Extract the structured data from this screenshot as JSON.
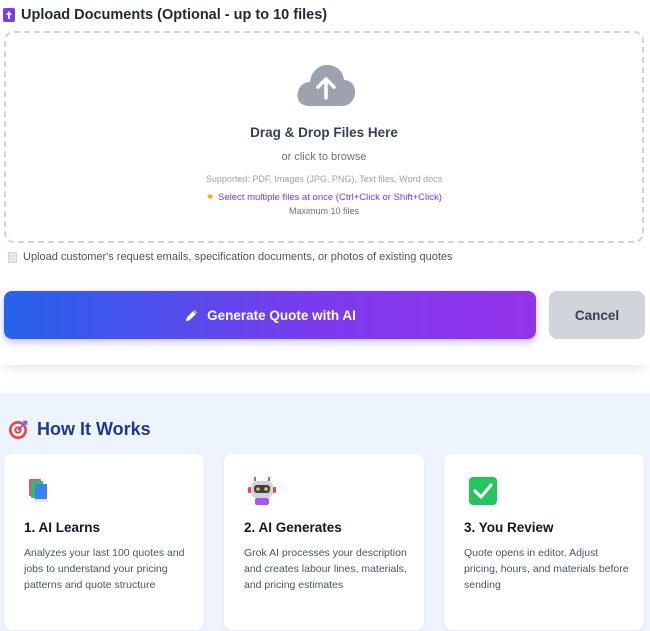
{
  "upload": {
    "title": "Upload Documents (Optional - up to 10 files)",
    "dropzone": {
      "heading": "Drag & Drop Files Here",
      "subheading": "or click to browse",
      "supported": "Supported: PDF, Images (JPG, PNG), Text files, Word docs",
      "multi_tip": "Select multiple files at once (Ctrl+Click or Shift+Click)",
      "max_files": "Maximum 10 files"
    },
    "hint": "Upload customer's request emails, specification documents, or photos of existing quotes"
  },
  "actions": {
    "generate_label": "Generate Quote with AI",
    "cancel_label": "Cancel"
  },
  "how_it_works": {
    "title": "How It Works",
    "steps": [
      {
        "icon": "books-icon",
        "title": "1. AI Learns",
        "description": "Analyzes your last 100 quotes and jobs to understand your pricing patterns and quote structure"
      },
      {
        "icon": "robot-icon",
        "title": "2. AI Generates",
        "description": "Grok AI processes your description and creates labour lines, materials, and pricing estimates"
      },
      {
        "icon": "check-mark-icon",
        "title": "3. You Review",
        "description": "Quote opens in editor. Adjust pricing, hours, and materials before sending"
      }
    ]
  },
  "colors": {
    "accent_purple": "#7c3aed",
    "gradient_start": "#2563eb",
    "gradient_end": "#9333ea",
    "heading_blue": "#1e3a8a",
    "section_bg": "#eef4fd",
    "check_green": "#22c55e"
  }
}
